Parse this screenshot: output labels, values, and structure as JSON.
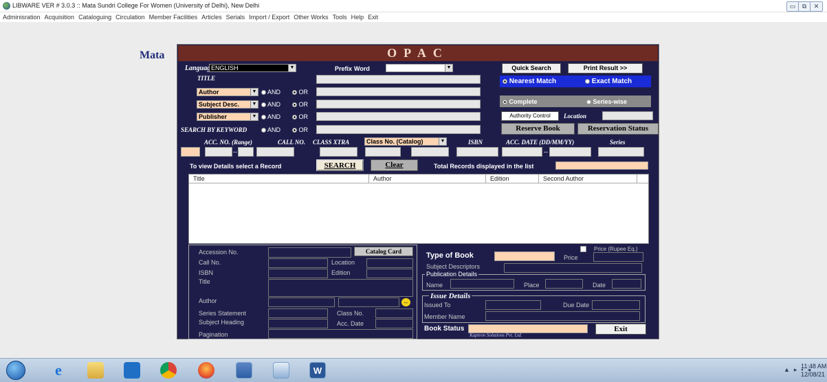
{
  "window": {
    "title": "LIBWARE VER # 3.0.3 :: Mata Sundri College For Women (University of Delhi), New Delhi"
  },
  "menu": [
    "Adminisration",
    "Acquisition",
    "Cataloguing",
    "Circulation",
    "Member Facilities",
    "Articles",
    "Serials",
    "Import / Export",
    "Other Works",
    "Tools",
    "Help",
    "Exit"
  ],
  "background_title": "Mata",
  "opac": {
    "header": "OPAC",
    "language_label": "Language",
    "language_value": "ENGLISH",
    "prefix_label": "Prefix",
    "word_label": "Word",
    "quick_search": "Quick Search",
    "print_result": "Print Result >>",
    "nearest_match": "Nearest Match",
    "exact_match": "Exact Match",
    "title_label": "TITLE",
    "author_combo": "Author",
    "subject_combo": "Subject Desc.",
    "publisher_combo": "Publisher",
    "and": "AND",
    "or": "OR",
    "search_by_keyword": "SEARCH BY KEYWORD",
    "complete": "Complete",
    "series_wise": "Series-wise",
    "authority_control": "Authority Control",
    "location_label": "Location",
    "reserve_book": "Reserve Book",
    "reservation_status": "Reservation Status",
    "acc_no_range": "ACC. NO. (Range)",
    "call_no": "CALL NO.",
    "class_xtra": "CLASS XTRA",
    "class_combo": "Class No. (Catalog)",
    "isbn": "ISBN",
    "acc_date": "ACC. DATE (DD/MM/YY)",
    "series": "Series",
    "range_dash": "--",
    "view_details": "To view Details select a Record",
    "search": "SEARCH",
    "clear": "Clear",
    "total_records": "Total Records displayed in the list",
    "grid_columns": [
      "Title",
      "Author",
      "Edition",
      "Second Author"
    ],
    "details": {
      "accession_no": "Accession No.",
      "catalog_card": "Catalog Card",
      "call_no": "Call No.",
      "location": "Location",
      "isbn": "ISBN",
      "edition": "Edition",
      "title": "Title",
      "author": "Author",
      "series_statement": "Series Statement",
      "class_no": "Class No.",
      "subject_heading": "Subject Heading",
      "acc_date": "Acc. Date",
      "pagination": "Pagination",
      "type_of_book": "Type of Book",
      "price": "Price",
      "price_rupee": "Price (Rupee Eq.)",
      "subject_descriptors": "Subject Descriptors",
      "publication_details": "Publication Details",
      "name": "Name",
      "place": "Place",
      "date": "Date",
      "issue_details": "Issue Details",
      "issued_to": "Issued To",
      "due_date": "Due Date",
      "member_name": "Member Name",
      "book_status": "Book Status",
      "exit": "Exit",
      "footer": "Kaptron Solutions Pvt. Ltd."
    }
  },
  "taskbar": {
    "time": "11:48 AM",
    "date": "12/08/21"
  },
  "colors": {
    "panel": "#1e1d4a",
    "header": "#6d2b24",
    "peach": "#fdd5b3",
    "exact_blue": "#1a2bd8"
  }
}
